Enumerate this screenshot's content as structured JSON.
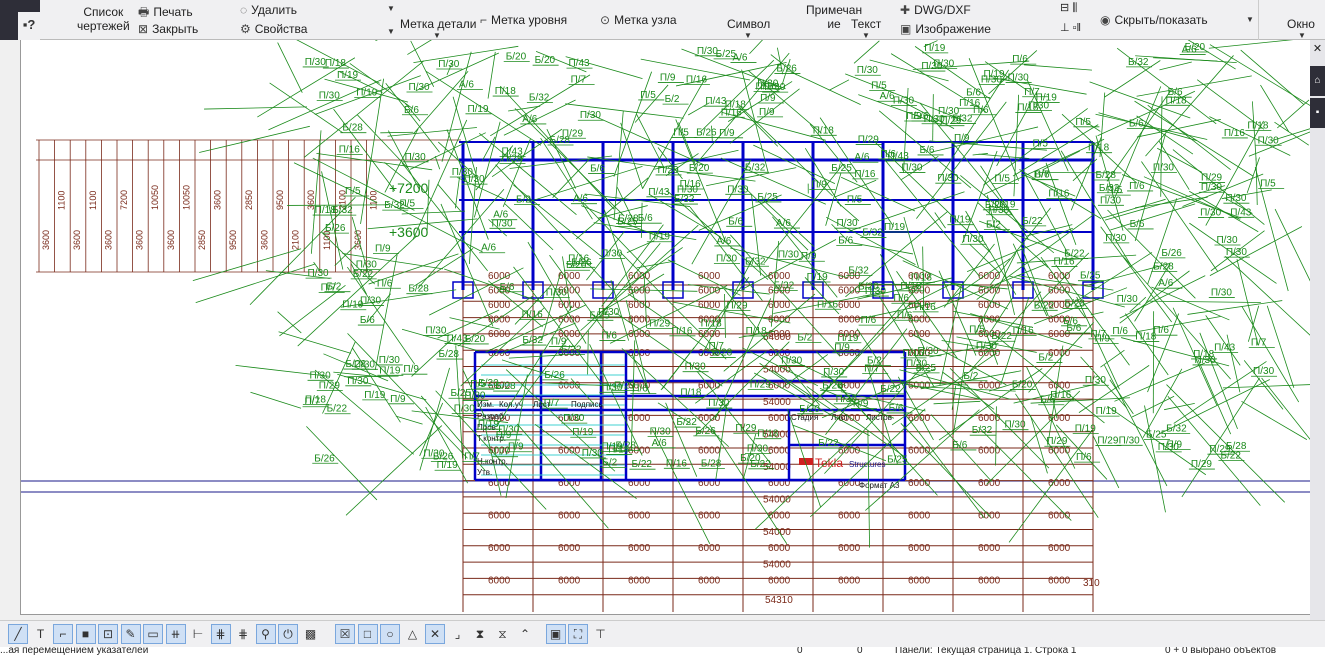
{
  "ribbon": {
    "help_icon": "help-icon",
    "drawing_list": [
      "Список",
      "чертежей"
    ],
    "print": "Печать",
    "close": "Закрыть",
    "delete": "Удалить",
    "properties": "Свойства",
    "part_mark": "Метка детали",
    "level_mark": "Метка уровня",
    "node_mark": "Метка узла",
    "symbol": "Символ",
    "note": [
      "Примечан",
      "ие"
    ],
    "text": "Текст",
    "dwg": "DWG/DXF",
    "image": "Изображение",
    "hide_show": "Скрыть/показать",
    "window": "Окно"
  },
  "drawing": {
    "span_label": "6000",
    "total_label": "54000",
    "overall_label": "54310",
    "end_label": "310",
    "levels": [
      "+7200",
      "+3600"
    ],
    "mark_labels": [
      "П/30",
      "П/30",
      "П/30",
      "П/6",
      "П/5",
      "Б/26",
      "П/19",
      "Б/28",
      "П/7",
      "П/9",
      "Б/2",
      "П/18",
      "П/16",
      "П/30",
      "П/29",
      "Б/6",
      "Б/20",
      "Б/22",
      "П/43",
      "Б/32",
      "А/6",
      "Б/25",
      "П/30"
    ],
    "left_dims": [
      "3600",
      "1100",
      "3600",
      "1100",
      "3600",
      "7200",
      "3600",
      "10050",
      "3600",
      "10050",
      "2850",
      "3600",
      "9500",
      "2850",
      "3600",
      "9500",
      "2100",
      "3600",
      "1100",
      "2100",
      "3600",
      "1100"
    ],
    "title_block": [
      "Изм.",
      "Кол.уч",
      "Лист",
      "Подпись",
      "Разраб.",
      "Пров.",
      "Т.контр.",
      "Н.контр.",
      "Утв.",
      "Стадия",
      "Лист",
      "Листов",
      "Формат А3"
    ],
    "logo": {
      "name": "Tekla",
      "sub": "Structures"
    }
  },
  "status": {
    "left": "...ая перемещением указателей",
    "coord_x": "0",
    "coord_y": "0",
    "panel": "Панели: Текущая страница 1. Строка 1",
    "selection": "0 + 0 выбрано объектов"
  },
  "colors": {
    "grid": "#7a2a1a",
    "frame": "#0000c8",
    "marks": "#1a8a1a",
    "accent": "#2e2e38"
  }
}
